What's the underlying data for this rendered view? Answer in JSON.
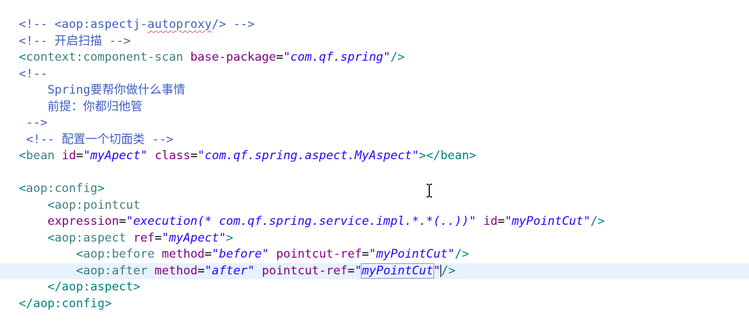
{
  "editor": {
    "l1_comment": "<!-- <aop:aspectj-",
    "l1_squiggle": "autoproxy",
    "l1_end": "/> -->",
    "l2": "<!-- 开启扫描 -->",
    "l3_open": "<",
    "l3_tag": "context:component-scan",
    "l3_attr": "base-package",
    "l3_val": "\"com.qf.spring\"",
    "l3_close": "/>",
    "l4": "<!--",
    "l5": "    Spring要帮你做什么事情",
    "l6": "    前提：你都归他管",
    "l7": " -->",
    "l8": " <!-- 配置一个切面类 -->",
    "l9_tag": "bean",
    "l9_attr1": "id",
    "l9_val1": "\"myApect\"",
    "l9_attr2": "class",
    "l9_val2": "\"com.qf.spring.aspect.MyAspect\"",
    "l9_endtag": "</bean>",
    "l11_tag": "aop:config",
    "l12_tag": "aop:pointcut",
    "l13_attr1": "expression",
    "l13_val1": "\"execution(* com.qf.spring.service.impl.*.*(..))\"",
    "l13_attr2": "id",
    "l13_val2": "\"myPointCut\"",
    "l14_tag": "aop:aspect",
    "l14_attr": "ref",
    "l14_val": "\"myApect\"",
    "l15_tag": "aop:before",
    "l15_attr1": "method",
    "l15_val1": "\"before\"",
    "l15_attr2": "pointcut-ref",
    "l15_val2": "\"myPointCut\"",
    "l16_tag": "aop:after",
    "l16_attr1": "method",
    "l16_val1": "\"after\"",
    "l16_attr2": "pointcut-ref",
    "l16_q": "\"",
    "l16_sel": "myPointCut",
    "l17_endtag": "</aop:aspect>",
    "l18_endtag": "</aop:config>"
  },
  "colors": {
    "comment": "#3f5fbf",
    "tag": "#3f7f7f",
    "attribute": "#7f007f",
    "value": "#2a00ff",
    "current_line": "#e8f2fe"
  }
}
